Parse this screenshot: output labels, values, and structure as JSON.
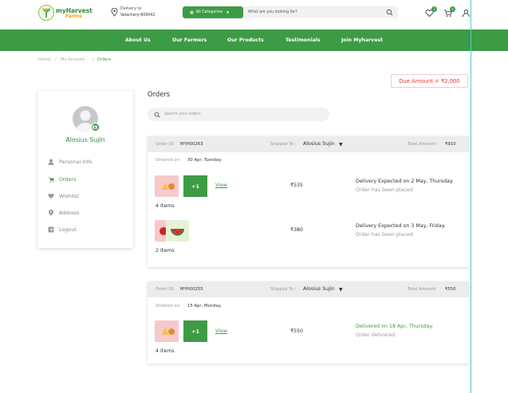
{
  "header": {
    "brand_top": "myHarvest",
    "brand_bottom": "Farms",
    "delivery_label": "Delivery to",
    "delivery_value": "Velachery-600042",
    "categories_label": "All Categories",
    "search_placeholder": "What are you looking for?",
    "wishlist_count": "3",
    "cart_count": "4"
  },
  "nav": {
    "items": [
      "About Us",
      "Our Farmers",
      "Our Products",
      "Testimonials",
      "Join Myharvest"
    ]
  },
  "breadcrumb": {
    "home": "Home",
    "account": "My Account",
    "current": "Orders"
  },
  "due": {
    "text": "Due Amount = ₹2,000"
  },
  "sidebar": {
    "user_name": "Alosius Sujin",
    "items": [
      {
        "label": "Personal Info",
        "icon": "user-icon"
      },
      {
        "label": "Orders",
        "icon": "cart-icon"
      },
      {
        "label": "Wishlist",
        "icon": "heart-icon"
      },
      {
        "label": "Address",
        "icon": "location-icon"
      },
      {
        "label": "Logout",
        "icon": "logout-icon"
      }
    ]
  },
  "orders": {
    "title": "Orders",
    "search_placeholder": "Search your orders",
    "list": [
      {
        "id_label": "Order ID:",
        "id": "MYH00263",
        "ship_label": "Shipped To :",
        "ship_to": "Alosius Sujin",
        "total_label": "Total Amount:",
        "total": "₹910",
        "ordered_label": "Ordered on:",
        "ordered_on": "30 Apr, Tuesday.",
        "shipments": [
          {
            "more": "+1",
            "view": "View",
            "price": "₹535",
            "expected": "Delivery Expected on 2 May, Thursday.",
            "status": "Order has been placed",
            "items": "4 Items"
          },
          {
            "price": "₹380",
            "expected": "Delivery Expected on 3 May, Friday.",
            "status": "Order has been placed",
            "items": "2 Items"
          }
        ]
      },
      {
        "id_label": "Order ID:",
        "id": "MYH00255",
        "ship_label": "Shipped To :",
        "ship_to": "Alosius Sujin",
        "total_label": "Total Amount:",
        "total": "₹550",
        "ordered_label": "Ordered on:",
        "ordered_on": "15 Apr, Monday.",
        "shipments": [
          {
            "more": "+1",
            "view": "View",
            "price": "₹550",
            "expected": "Delivered on 18 Apr, Thursday.",
            "status": "Order delivered",
            "items": "4 Items"
          }
        ]
      }
    ]
  },
  "colors": {
    "brand_green": "#3d9b45",
    "due_red": "#e53935",
    "accent_orange": "#e9a21a"
  }
}
